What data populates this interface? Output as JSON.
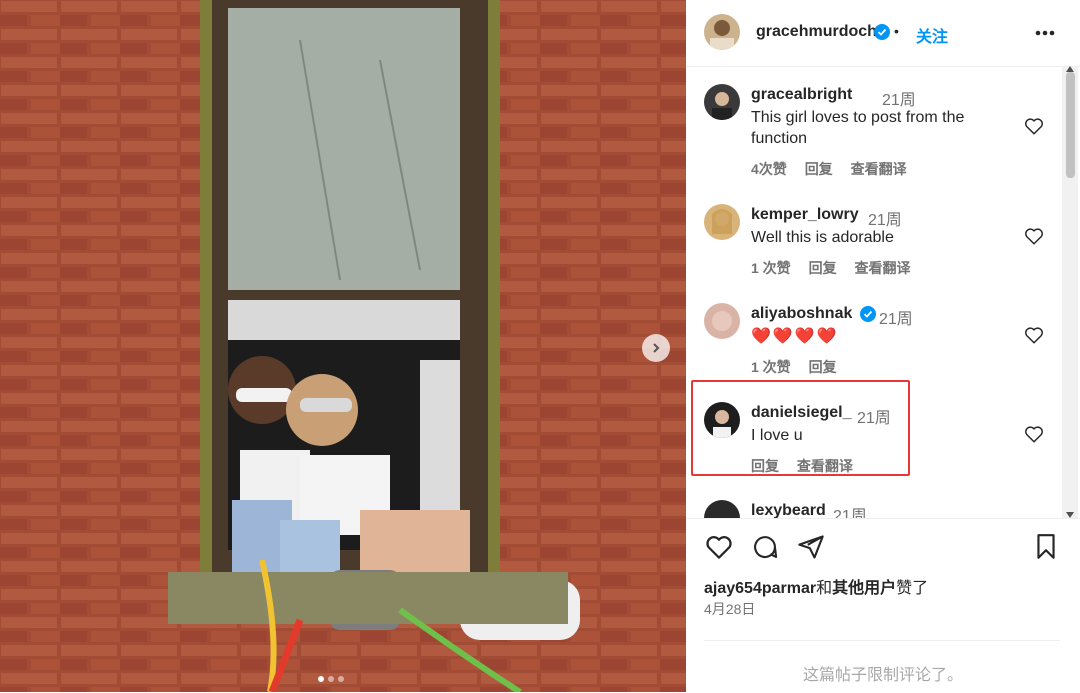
{
  "post": {
    "author": "gracehmurdoch",
    "follow_label": "关注",
    "dot": "•",
    "more_icon": "more-horizontal-icon"
  },
  "comments": [
    {
      "user": "gracealbright",
      "time": "21周",
      "text_line1": "This girl loves to post from the",
      "text_line2": "function",
      "likes": "4次赞",
      "reply": "回复",
      "translate": "查看翻译",
      "verified": false
    },
    {
      "user": "kemper_lowry",
      "time": "21周",
      "text": "Well this is adorable",
      "likes": "1 次赞",
      "reply": "回复",
      "translate": "查看翻译",
      "verified": false
    },
    {
      "user": "aliyaboshnak",
      "time": "21周",
      "text": "❤️❤️❤️❤️",
      "likes": "1 次赞",
      "reply": "回复",
      "verified": true
    },
    {
      "user": "danielsiegel_",
      "time": "21周",
      "text": "I love u",
      "reply": "回复",
      "translate": "查看翻译",
      "verified": false
    },
    {
      "user": "lexybeard",
      "time": "21周",
      "verified": false
    }
  ],
  "footer": {
    "liked_by_user": "ajay654parmar",
    "liked_by_and": "和",
    "liked_by_others": "其他用户",
    "liked_suffix": "赞了",
    "date": "4月28日",
    "comments_limited": "这篇帖子限制评论了。"
  },
  "colors": {
    "accent_blue": "#0095f6",
    "highlight_red": "#e53935",
    "brick": "#9a4a35"
  }
}
